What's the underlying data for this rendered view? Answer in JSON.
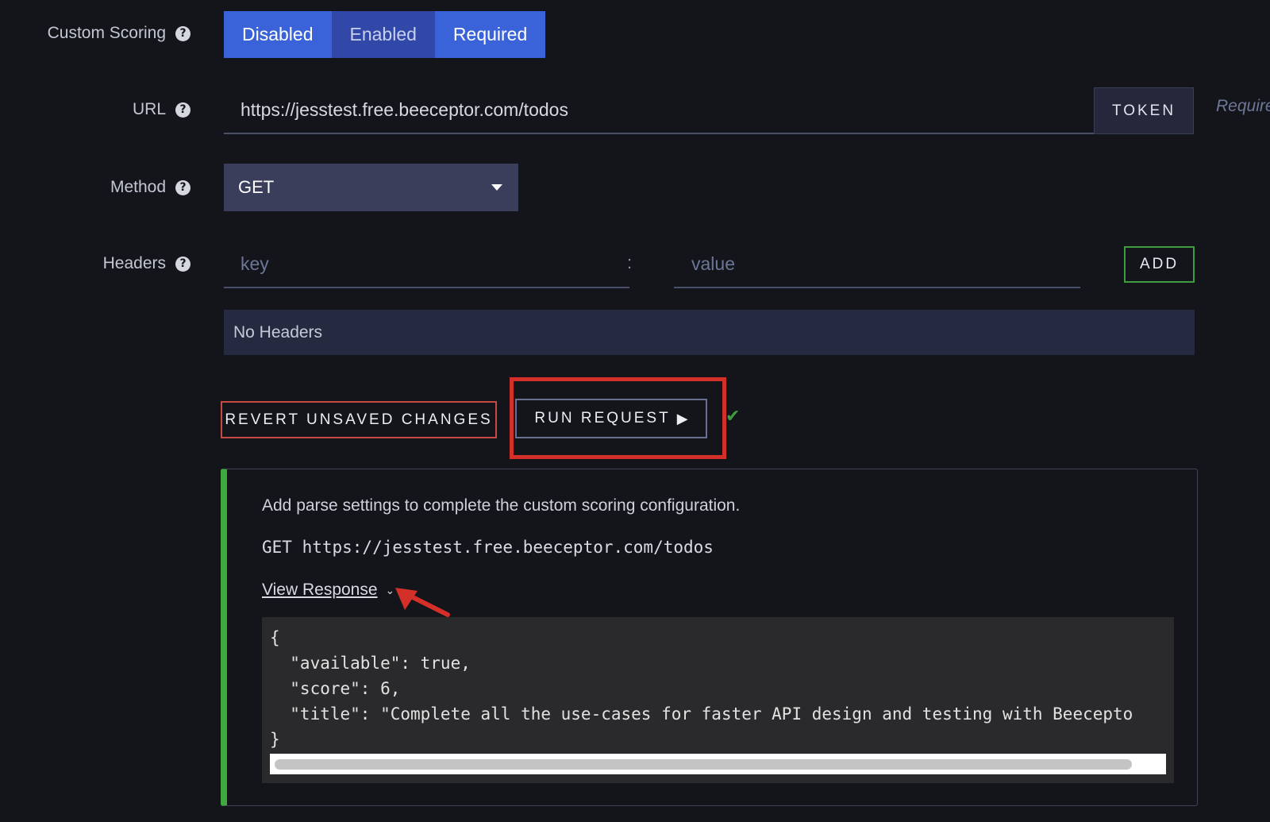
{
  "fields": {
    "custom_scoring": {
      "label": "Custom Scoring",
      "options": [
        "Disabled",
        "Enabled",
        "Required"
      ],
      "selected": "Disabled"
    },
    "url": {
      "label": "URL",
      "value": "https://jesstest.free.beeceptor.com/todos",
      "token_label": "TOKEN",
      "hint": "Require"
    },
    "method": {
      "label": "Method",
      "value": "GET"
    },
    "headers": {
      "label": "Headers",
      "key_placeholder": "key",
      "separator": ":",
      "value_placeholder": "value",
      "add_label": "ADD",
      "empty_text": "No Headers"
    }
  },
  "actions": {
    "revert_label": "REVERT UNSAVED CHANGES",
    "run_label": "RUN REQUEST",
    "run_icon": "play-icon",
    "status_icon": "check-icon"
  },
  "result": {
    "message": "Add parse settings to complete the custom scoring configuration.",
    "request_line": "GET https://jesstest.free.beeceptor.com/todos",
    "view_response_label": "View Response",
    "response_lines": [
      "{",
      "  \"available\": true,",
      "  \"score\": 6,",
      "  \"title\": \"Complete all the use-cases for faster API design and testing with Beecepto",
      "}"
    ]
  },
  "colors": {
    "background": "#13151b",
    "accent_blue": "#3b63d9",
    "success_green": "#3fa83f",
    "danger_red": "#c74a45",
    "annotation_red": "#d3302a"
  }
}
